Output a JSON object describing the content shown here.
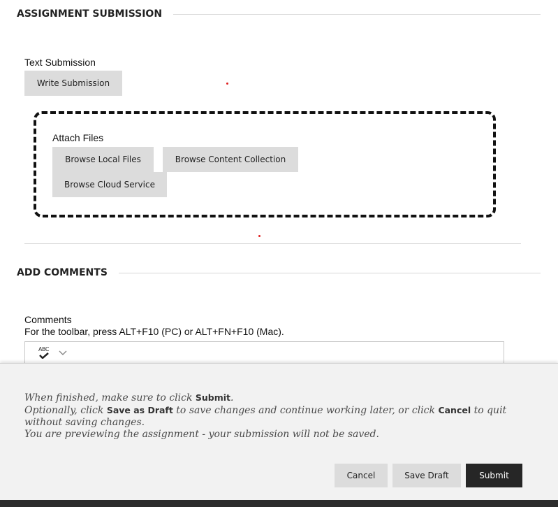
{
  "assignment_section": {
    "header": "ASSIGNMENT SUBMISSION",
    "text_submission_label": "Text Submission",
    "write_submission_button": "Write Submission",
    "attach_files_label": "Attach Files",
    "browse_local_button": "Browse Local Files",
    "browse_content_button": "Browse Content Collection",
    "browse_cloud_button": "Browse Cloud Service"
  },
  "comments_section": {
    "header": "ADD COMMENTS",
    "comments_label": "Comments",
    "toolbar_hint": "For the toolbar, press ALT+F10 (PC) or ALT+FN+F10 (Mac).",
    "toolbar_icons": [
      "spellcheck-icon",
      "chevron-down-icon"
    ],
    "spell_icon_text": "ABC"
  },
  "instructions": {
    "line1_pre": "When finished, make sure to click ",
    "line1_emph": "Submit",
    "line1_post": ".",
    "line2_pre": "Optionally, click ",
    "line2_emph1": "Save as Draft",
    "line2_mid": " to save changes and continue working later, or click ",
    "line2_emph2": "Cancel",
    "line2_post": " to quit without saving changes.",
    "line3": "You are previewing the assignment - your submission will not be saved."
  },
  "actions": {
    "cancel": "Cancel",
    "save_draft": "Save Draft",
    "submit": "Submit"
  },
  "colors": {
    "button_gray": "#dcdcdc",
    "submit_dark": "#262626",
    "panel_bg": "#f2f2f2",
    "marker_red": "#e02020"
  }
}
